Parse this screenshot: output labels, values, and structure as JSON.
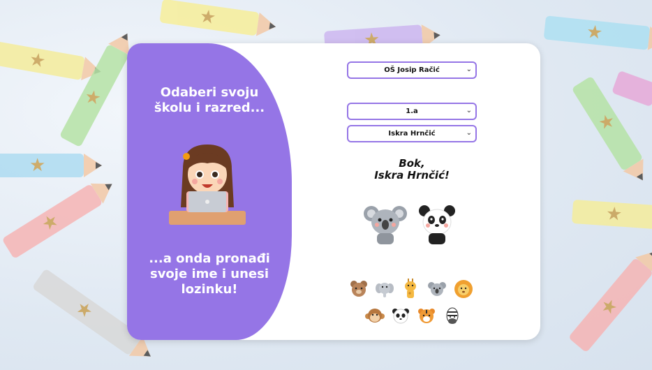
{
  "form": {
    "school_value": "OŠ Josip Račić",
    "class_value": "1.a",
    "student_value": "Iskra Hrnčić"
  },
  "left_panel": {
    "heading": "Odaberi svoju školu i razred...",
    "footer": "...a onda pronađi svoje ime i unesi lozinku!"
  },
  "greeting": {
    "line1": "Bok,",
    "line2": "Iskra Hrnčić!"
  },
  "animals": {
    "selected": [
      "koala",
      "panda"
    ],
    "grid": [
      "bear",
      "elephant",
      "giraffe",
      "koala",
      "lion",
      "monkey",
      "panda",
      "tiger",
      "zebra"
    ]
  },
  "colors": {
    "accent": "#9575e6",
    "card": "#ffffff",
    "background": "#dfe8f2"
  }
}
